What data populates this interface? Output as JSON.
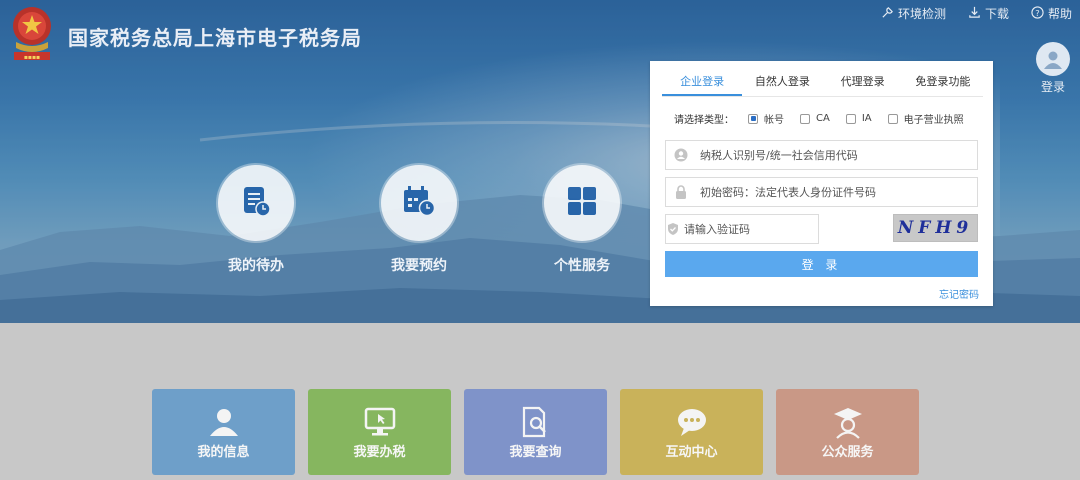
{
  "header": {
    "title": "国家税务总局上海市电子税务局",
    "links": [
      {
        "label": "环境检测",
        "icon": "tools-icon"
      },
      {
        "label": "下载",
        "icon": "download-icon"
      },
      {
        "label": "帮助",
        "icon": "help-icon"
      }
    ],
    "user_login_label": "登录"
  },
  "services": [
    {
      "label": "我的待办",
      "icon": "document-clock-icon"
    },
    {
      "label": "我要预约",
      "icon": "calendar-clock-icon"
    },
    {
      "label": "个性服务",
      "icon": "grid-icon"
    }
  ],
  "login": {
    "tabs": [
      {
        "label": "企业登录",
        "active": true
      },
      {
        "label": "自然人登录",
        "active": false
      },
      {
        "label": "代理登录",
        "active": false
      },
      {
        "label": "免登录功能",
        "active": false
      }
    ],
    "type_label": "请选择类型：",
    "types": [
      {
        "label": "帐号",
        "selected": true
      },
      {
        "label": "CA",
        "selected": false
      },
      {
        "label": "IA",
        "selected": false
      },
      {
        "label": "电子营业执照",
        "selected": false
      }
    ],
    "taxpayer_placeholder": "纳税人识别号/统一社会信用代码",
    "password_placeholder": "初始密码：法定代表人身份证件号码",
    "captcha_placeholder": "请输入验证码",
    "captcha_text": "NFH9",
    "submit_label": "登 录",
    "forgot_label": "忘记密码"
  },
  "tiles": [
    {
      "label": "我的信息",
      "icon": "person-icon",
      "color": "#6e9fc9"
    },
    {
      "label": "我要办税",
      "icon": "monitor-pointer-icon",
      "color": "#86b65f"
    },
    {
      "label": "我要查询",
      "icon": "search-document-icon",
      "color": "#7f93c9"
    },
    {
      "label": "互动中心",
      "icon": "chat-bubble-icon",
      "color": "#c9b25a"
    },
    {
      "label": "公众服务",
      "icon": "graduate-icon",
      "color": "#c99886"
    }
  ]
}
